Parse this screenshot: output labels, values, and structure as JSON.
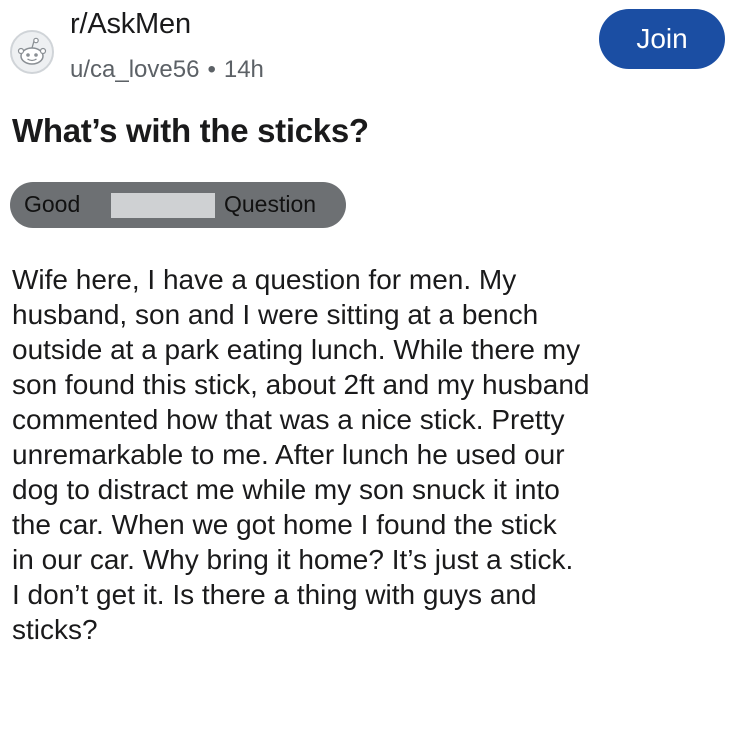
{
  "post": {
    "subreddit": "r/AskMen",
    "author": "u/ca_love56",
    "separator": "•",
    "age": "14h",
    "join_label": "Join",
    "title": "What’s with the sticks?",
    "flair": {
      "word1": "Good",
      "word2": "Question"
    },
    "body_lines": [
      "Wife here, I have a question for men. My",
      "husband, son and I were sitting at a bench",
      "outside at a park eating lunch. While there my",
      "son found this stick, about 2ft and my husband",
      "commented how that was a nice stick. Pretty",
      "unremarkable to me. After lunch he used our",
      "dog to distract me while my son snuck it into",
      "the car. When we got home I found the stick",
      "in our car. Why bring it home? It’s just a stick.",
      "I don’t get it. Is there a thing with guys and",
      "sticks?"
    ]
  },
  "icons": {
    "avatar": "reddit-snoo-icon"
  },
  "colors": {
    "join_button": "#1b4ea3",
    "flair_background": "#6d7073",
    "redaction": "#cfd1d3"
  }
}
